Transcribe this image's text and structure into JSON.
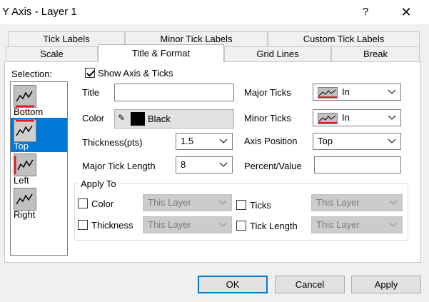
{
  "window": {
    "title": "Y Axis - Layer 1",
    "help_label": "?",
    "close_label": "✕"
  },
  "tabs_row1": [
    "Tick Labels",
    "Minor Tick Labels",
    "Custom Tick Labels"
  ],
  "tabs_row2": [
    "Scale",
    "Title & Format",
    "Grid Lines",
    "Break"
  ],
  "active_tab": "Title & Format",
  "selection": {
    "label": "Selection:",
    "items": [
      "Bottom",
      "Top",
      "Left",
      "Right"
    ],
    "selected": "Top"
  },
  "show_axis": {
    "label": "Show Axis & Ticks",
    "checked": true
  },
  "fields": {
    "title_label": "Title",
    "title_value": "",
    "color_label": "Color",
    "color_value": "Black",
    "color_swatch": "#000000",
    "thickness_label": "Thickness(pts)",
    "thickness_value": "1.5",
    "major_tick_length_label": "Major Tick Length",
    "major_tick_length_value": "8",
    "major_ticks_label": "Major Ticks",
    "major_ticks_value": "In",
    "minor_ticks_label": "Minor Ticks",
    "minor_ticks_value": "In",
    "axis_position_label": "Axis Position",
    "axis_position_value": "Top",
    "percent_value_label": "Percent/Value",
    "percent_value_value": ""
  },
  "apply_to": {
    "title": "Apply To",
    "color_label": "Color",
    "thickness_label": "Thickness",
    "ticks_label": "Ticks",
    "tick_length_label": "Tick Length",
    "combo_value": "This Layer"
  },
  "buttons": {
    "ok": "OK",
    "cancel": "Cancel",
    "apply": "Apply"
  },
  "colors": {
    "selection_highlight": "#0078d7",
    "default_button_border": "#0078d7",
    "axis_marker": "#e02020"
  }
}
